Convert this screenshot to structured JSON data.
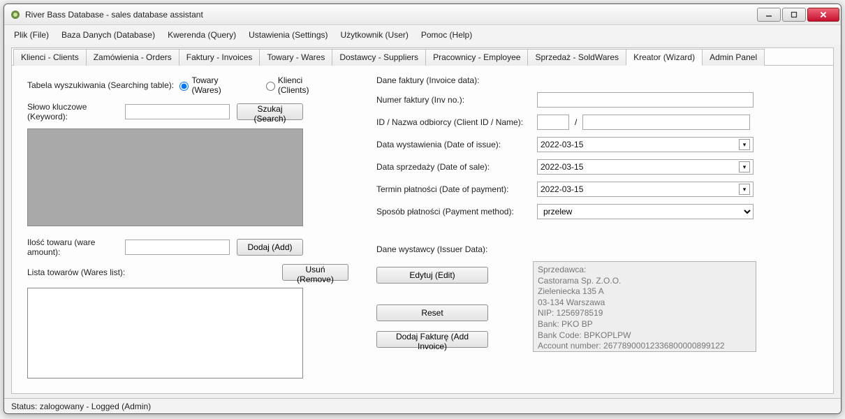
{
  "window": {
    "title": "River Bass Database - sales database assistant"
  },
  "menu": {
    "file": "Plik (File)",
    "database": "Baza Danych (Database)",
    "query": "Kwerenda (Query)",
    "settings": "Ustawienia (Settings)",
    "user": "Użytkownik (User)",
    "help": "Pomoc (Help)"
  },
  "tabs": {
    "clients": "Klienci - Clients",
    "orders": "Zamówienia - Orders",
    "invoices": "Faktury - Invoices",
    "wares": "Towary - Wares",
    "suppliers": "Dostawcy - Suppliers",
    "employee": "Pracownicy - Employee",
    "soldwares": "Sprzedaż - SoldWares",
    "wizard": "Kreator (Wizard)",
    "admin": "Admin Panel"
  },
  "wizard": {
    "search_table_label": "Tabela wyszukiwania (Searching table):",
    "radio_wares": "Towary (Wares)",
    "radio_clients": "Klienci (Clients)",
    "keyword_label": "Słowo kluczowe (Keyword):",
    "search_btn": "Szukaj (Search)",
    "amount_label": "Ilość towaru (ware amount):",
    "add_btn": "Dodaj (Add)",
    "wares_list_label": "Lista towarów (Wares list):",
    "remove_btn": "Usuń (Remove)"
  },
  "invoice": {
    "data_label": "Dane faktury (Invoice data):",
    "number_label": "Numer faktury (Inv no.):",
    "clientid_label": "ID / Nazwa odbiorcy (Client ID / Name):",
    "slash": "/",
    "date_issue_label": "Data wystawienia (Date of issue):",
    "date_issue_value": "2022-03-15",
    "date_sale_label": "Data sprzedaży (Date of sale):",
    "date_sale_value": "2022-03-15",
    "date_payment_label": "Termin płatności (Date of payment):",
    "date_payment_value": "2022-03-15",
    "payment_method_label": "Sposób płatności (Payment method):",
    "payment_method_value": "przelew",
    "issuer_label": "Dane wystawcy (Issuer Data):",
    "edit_btn": "Edytuj (Edit)",
    "reset_btn": "Reset",
    "add_invoice_btn": "Dodaj Fakturę (Add Invoice)",
    "issuer_text": "Sprzedawca:\nCastorama Sp. Z.O.O.\nZieleniecka 135 A\n03-134 Warszawa\nNIP: 1256978519\nBank: PKO BP\nBank Code: BPKOPLPW\nAccount number: 26778900012336800000899122"
  },
  "status": {
    "text": "Status: zalogowany - Logged (Admin)"
  }
}
